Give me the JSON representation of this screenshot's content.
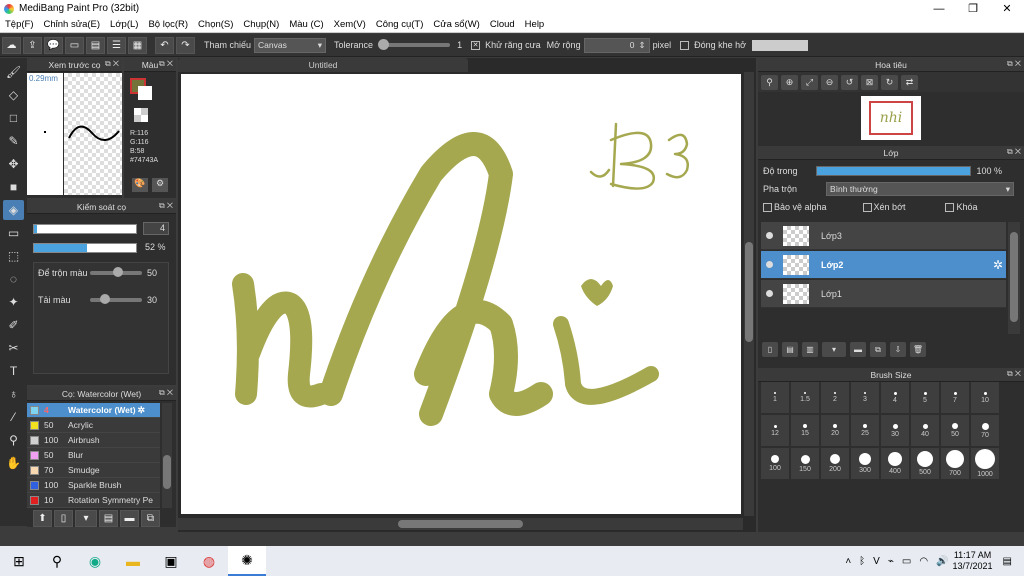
{
  "app": {
    "title": "MediBang Paint Pro (32bit)"
  },
  "menu": [
    "Tệp(F)",
    "Chỉnh sửa(E)",
    "Lớp(L)",
    "Bộ lọc(R)",
    "Chọn(S)",
    "Chụp(N)",
    "Màu (C)",
    "Xem(V)",
    "Công cụ(T)",
    "Cửa sổ(W)",
    "Cloud",
    "Help"
  ],
  "toolbar": {
    "ref_label": "Tham chiếu",
    "ref_value": "Canvas",
    "tolerance_label": "Tolerance",
    "tolerance_value": "1",
    "antialias_label": "Khử răng cưa",
    "expand_label": "Mở rộng",
    "expand_value": "0",
    "expand_unit": "pixel",
    "gap_label": "Đóng khe hở"
  },
  "preview": {
    "title": "Xem trước cọ",
    "size": "0.29mm"
  },
  "color": {
    "title": "Màu",
    "r": "R:116",
    "g": "G:116",
    "b": "B:58",
    "hex": "#74743A",
    "main": "#74743A"
  },
  "brush_control": {
    "title": "Kiểm soát cọ",
    "size_value": "4",
    "opacity_value": "52 %",
    "blend_label": "Để trộn màu",
    "blend_value": "50",
    "reload_label": "Tải màu",
    "reload_value": "30"
  },
  "brush_list": {
    "title": "Cọ: Watercolor (Wet)",
    "items": [
      {
        "num": "4",
        "name": "Watercolor (Wet)",
        "color": "#7fd4f0"
      },
      {
        "num": "50",
        "name": "Acrylic",
        "color": "#f0e020"
      },
      {
        "num": "100",
        "name": "Airbrush",
        "color": "#d0d0d0"
      },
      {
        "num": "50",
        "name": "Blur",
        "color": "#f0a0f0"
      },
      {
        "num": "70",
        "name": "Smudge",
        "color": "#f8d8b0"
      },
      {
        "num": "100",
        "name": "Sparkle Brush",
        "color": "#3060e0"
      },
      {
        "num": "10",
        "name": "Rotation Symmetry Pe",
        "color": "#e02020"
      }
    ]
  },
  "canvas": {
    "tab": "Untitled",
    "text_main": "nhi",
    "text_note": "B3",
    "stroke_color": "#a5a84f"
  },
  "navigator": {
    "title": "Hoa tiêu",
    "thumb_text": "nhi"
  },
  "layers": {
    "title": "Lớp",
    "opacity_label": "Độ trong",
    "opacity_value": "100 %",
    "blend_label": "Pha trộn",
    "blend_value": "Bình thường",
    "protect_alpha": "Bảo vệ alpha",
    "clipping": "Xén bớt",
    "lock": "Khóa",
    "items": [
      "Lớp3",
      "Lớp2",
      "Lớp1"
    ]
  },
  "brush_size": {
    "title": "Brush Size",
    "sizes": [
      "1",
      "1.5",
      "2",
      "3",
      "4",
      "5",
      "7",
      "10",
      "12",
      "15",
      "20",
      "25",
      "30",
      "40",
      "50",
      "70",
      "100",
      "150",
      "200",
      "300",
      "400",
      "500",
      "700",
      "1000"
    ]
  },
  "taskbar": {
    "time": "11:17 AM",
    "date": "13/7/2021"
  }
}
